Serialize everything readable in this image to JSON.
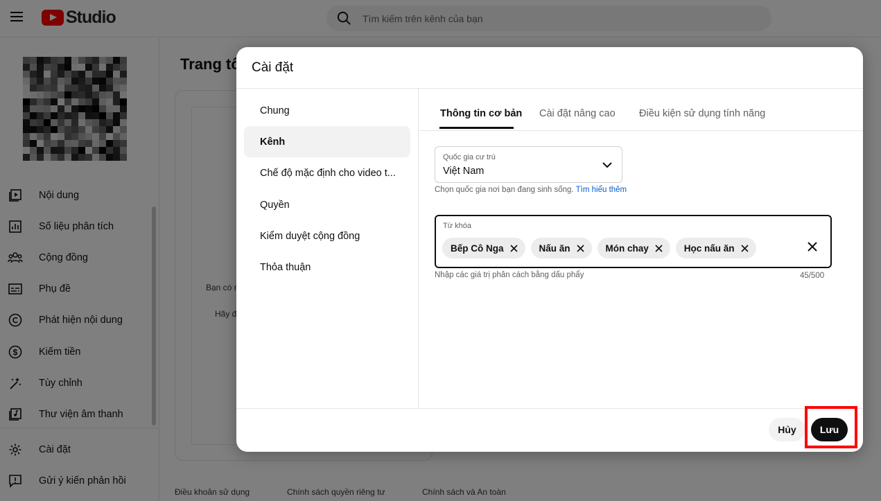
{
  "app": {
    "logo_text": "Studio"
  },
  "search": {
    "placeholder": "Tìm kiếm trên kênh của bạn"
  },
  "sidebar": {
    "items": [
      {
        "label": "Nội dung",
        "icon": "content-icon"
      },
      {
        "label": "Số liệu phân tích",
        "icon": "analytics-icon"
      },
      {
        "label": "Cộng đồng",
        "icon": "community-icon"
      },
      {
        "label": "Phụ đề",
        "icon": "subtitles-icon"
      },
      {
        "label": "Phát hiện nội dung",
        "icon": "copyright-icon"
      },
      {
        "label": "Kiếm tiền",
        "icon": "monetization-icon"
      },
      {
        "label": "Tùy chỉnh",
        "icon": "customization-icon"
      },
      {
        "label": "Thư viện âm thanh",
        "icon": "audio-library-icon"
      }
    ],
    "bottom": [
      {
        "label": "Cài đặt",
        "icon": "gear-icon"
      },
      {
        "label": "Gửi ý kiến phản hồi",
        "icon": "feedback-icon"
      }
    ]
  },
  "main": {
    "title": "Trang tổ",
    "card_text1": "Bạn có n",
    "card_text2": "Hãy đ",
    "footer": [
      "Điều khoản sử dụng",
      "Chính sách quyền riêng tư",
      "Chính sách và An toàn"
    ]
  },
  "dialog": {
    "title": "Cài đặt",
    "left_menu": [
      "Chung",
      "Kênh",
      "Chế độ mặc định cho video t...",
      "Quyền",
      "Kiểm duyệt cộng đồng",
      "Thỏa thuận"
    ],
    "active_left": "Kênh",
    "tabs": [
      "Thông tin cơ bản",
      "Cài đặt nâng cao",
      "Điều kiện sử dụng tính năng"
    ],
    "active_tab": "Thông tin cơ bản",
    "country": {
      "label": "Quốc gia cư trú",
      "value": "Việt Nam",
      "helper": "Chọn quốc gia nơi bạn đang sinh sống.",
      "helper_link": "Tìm hiểu thêm"
    },
    "keywords": {
      "label": "Từ khóa",
      "chips": [
        "Bếp Cô Nga",
        "Nấu ăn",
        "Món chay",
        "Học nấu ăn"
      ],
      "helper": "Nhập các giá trị phân cách bằng dấu phẩy",
      "count": "45/500"
    },
    "buttons": {
      "cancel": "Hủy",
      "save": "Lưu"
    }
  },
  "colors": {
    "accent": "#0f0f0f",
    "link": "#065fd4",
    "brand": "#ff0000",
    "highlight": "#ff0000"
  }
}
